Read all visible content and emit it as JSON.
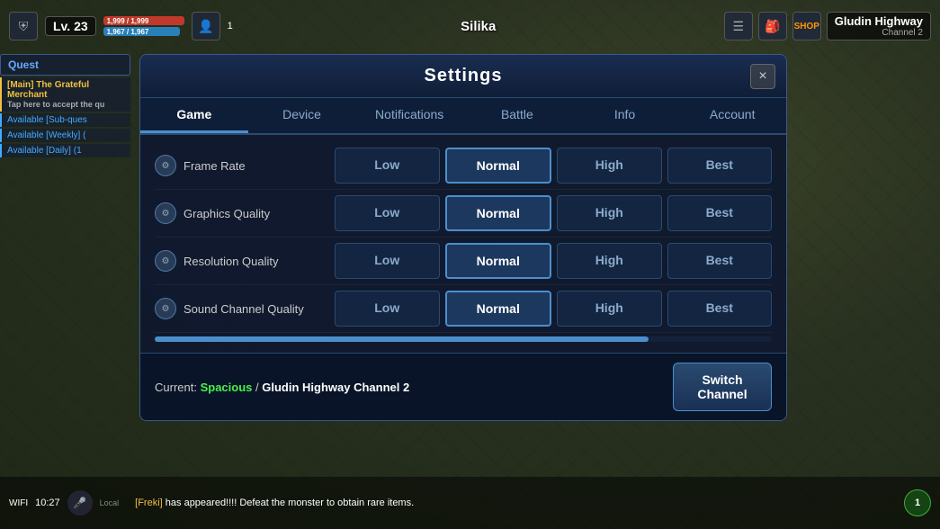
{
  "game": {
    "bg_color": "#4a5a3a"
  },
  "hud": {
    "level": "Lv. 23",
    "hp_current": "1,999",
    "hp_max": "1,999",
    "mp_current": "1,967",
    "mp_max": "1,967",
    "player_name": "Silika",
    "location": "Gludin Highway",
    "channel": "Channel 2",
    "wifi": "WIFI",
    "time": "10:27",
    "chat_name": "[Freki]",
    "chat_msg": " has appeared!!!! Defeat the monster to obtain rare items."
  },
  "quest": {
    "label": "Quest",
    "main_quest": "[Main] The Grateful Merchant",
    "main_sub": "Tap here to accept the qu",
    "available1": "Available [Sub-ques",
    "available2": "Available [Weekly] (",
    "available3": "Available [Daily] (1"
  },
  "settings": {
    "title": "Settings",
    "close_label": "×",
    "tabs": [
      {
        "id": "game",
        "label": "Game",
        "active": true
      },
      {
        "id": "device",
        "label": "Device",
        "active": false
      },
      {
        "id": "notifications",
        "label": "Notifications",
        "active": false
      },
      {
        "id": "battle",
        "label": "Battle",
        "active": false
      },
      {
        "id": "info",
        "label": "Info",
        "active": false
      },
      {
        "id": "account",
        "label": "Account",
        "active": false
      }
    ],
    "rows": [
      {
        "id": "frame-rate",
        "label": "Frame Rate",
        "options": [
          "Low",
          "Normal",
          "High",
          "Best"
        ],
        "selected": "Normal"
      },
      {
        "id": "graphics-quality",
        "label": "Graphics Quality",
        "options": [
          "Low",
          "Normal",
          "High",
          "Best"
        ],
        "selected": "Normal"
      },
      {
        "id": "resolution-quality",
        "label": "Resolution Quality",
        "options": [
          "Low",
          "Normal",
          "High",
          "Best"
        ],
        "selected": "Normal"
      },
      {
        "id": "sound-channel",
        "label": "Sound Channel Quality",
        "options": [
          "Low",
          "Normal",
          "High",
          "Best"
        ],
        "selected": "Normal"
      }
    ],
    "footer": {
      "current_label": "Current:",
      "spacious": "Spacious",
      "separator": " / ",
      "channel_name": "Gludin Highway Channel 2",
      "switch_label": "Switch\nChannel"
    }
  }
}
